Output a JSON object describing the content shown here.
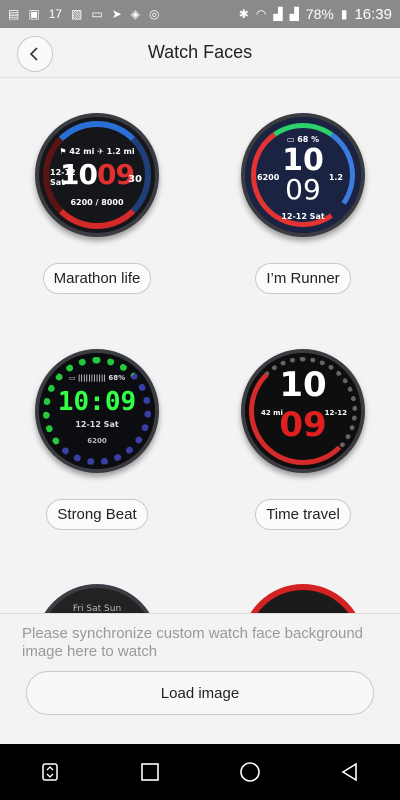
{
  "status_bar": {
    "left_icons": [
      "message-icon",
      "gallery-icon",
      "notification-count",
      "image-icon",
      "cast-icon",
      "navigation-icon",
      "location-icon",
      "sync-icon"
    ],
    "notification_count": "17",
    "battery_percent": "78%",
    "clock": "16:39"
  },
  "header": {
    "title": "Watch Faces",
    "back_icon": "chevron-left-icon"
  },
  "faces": [
    {
      "name": "Marathon life",
      "display": {
        "top": "⚑ 42 mi   ✈ 1.2 mi",
        "hour": "10",
        "minute": "09",
        "date_line1": "12-12",
        "date_line2": "Sat",
        "heart_rate": "30",
        "steps": "6200 / 8000"
      }
    },
    {
      "name": "I’m Runner",
      "display": {
        "battery": "▭ 68 %",
        "hour": "10",
        "minute": "09",
        "left_value": "6200",
        "right_value": "1.2",
        "date": "12-12 Sat"
      }
    },
    {
      "name": "Strong Beat",
      "display": {
        "battery": "▭ ||||||||||| 68%",
        "time": "10:09",
        "date": "12-12  Sat",
        "steps": "6200"
      }
    },
    {
      "name": "Time travel",
      "display": {
        "hour": "10",
        "minute": "09",
        "distance": "42 mi",
        "date": "12-12"
      }
    }
  ],
  "partial_faces": [
    {
      "text": "Fri  Sat  Sun"
    },
    {
      "text": ""
    }
  ],
  "bottom": {
    "hint": "Please synchronize custom watch face background image here to watch",
    "load_button": "Load image"
  },
  "nav_bar": {
    "buttons": [
      "recent-apps-icon",
      "home-square-icon",
      "home-circle-icon",
      "back-triangle-icon"
    ]
  },
  "colors": {
    "background": "#f3f3f3",
    "status_bar": "#8a8a8a",
    "nav_bar": "#000000",
    "accent_red": "#e03030",
    "accent_green": "#2bd26a",
    "accent_blue": "#2a6fd6"
  }
}
